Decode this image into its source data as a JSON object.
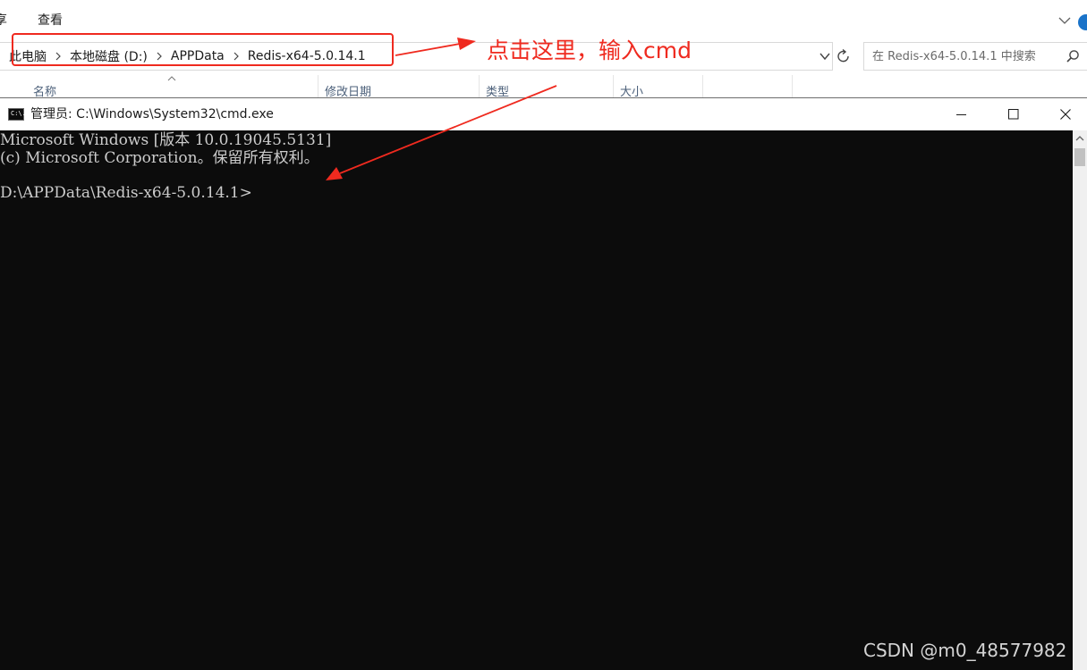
{
  "explorer": {
    "ribbon_tabs": [
      "享",
      "查看"
    ],
    "breadcrumbs": [
      "此电脑",
      "本地磁盘 (D:)",
      "APPData",
      "Redis-x64-5.0.14.1"
    ],
    "search_placeholder": "在 Redis-x64-5.0.14.1 中搜索",
    "columns": [
      "名称",
      "修改日期",
      "类型",
      "大小"
    ]
  },
  "annotation": {
    "text": "点击这里，输入cmd",
    "color": "#ef2a1f"
  },
  "cmd": {
    "title": "管理员: C:\\Windows\\System32\\cmd.exe",
    "icon_text": "C:\\.",
    "lines": [
      "Microsoft Windows [版本 10.0.19045.5131]",
      "(c) Microsoft Corporation。保留所有权利。"
    ],
    "prompt": "D:\\APPData\\Redis-x64-5.0.14.1>"
  },
  "watermark": "CSDN @m0_48577982",
  "icons": [
    "chevron-down-icon",
    "help-icon",
    "refresh-icon",
    "search-icon",
    "cmd-icon",
    "minimize-icon",
    "maximize-icon",
    "close-icon",
    "scroll-up-icon"
  ]
}
